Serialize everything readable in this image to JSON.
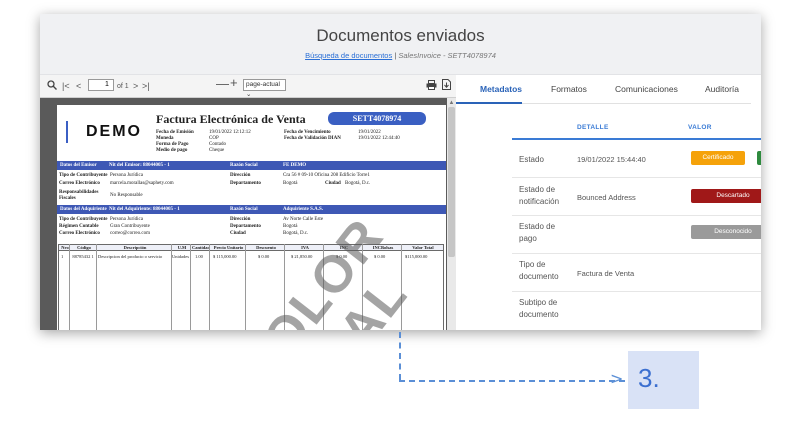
{
  "header": {
    "title": "Documentos enviados",
    "breadcrumb_link": "Búsqueda de documentos",
    "breadcrumb_sep": "|",
    "breadcrumb_current": "SalesInvoice - SETT4078974"
  },
  "viewer": {
    "page_input": "1",
    "page_of": "of 1",
    "zoom_select": "page-actual",
    "doc": {
      "logo": "DEMO",
      "title": "Factura Electrónica de Venta",
      "number": "SETT4078974",
      "meta_left_labels": [
        "Fecha de Emisión",
        "Moneda",
        "Forma de Pago",
        "Medio de pago"
      ],
      "meta_left_values": [
        "19/01/2022 12:12:12",
        "COP",
        "Contado",
        "Cheque"
      ],
      "meta_right_labels": [
        "Fecha de Vencimiento",
        "Fecha de Validación DIAN"
      ],
      "meta_right_values": [
        "19/01/2022",
        "19/01/2022 12:44:40"
      ],
      "emisor_band": [
        "Datos del Emisor",
        "Nit del Emisor: 88044005 - 1",
        "Razón Social",
        "FE DEMO"
      ],
      "emisor_rows": [
        [
          "Tipo de Contribuyente",
          "Persona Jurídica",
          "Dirección",
          "Cra 56 # 09-10 Oficina 208 Edificio Torre1"
        ],
        [
          "Correo Electrónico",
          "marcela.morallas@saphety.com",
          "Departamento",
          "Bogotá",
          "Ciudad",
          "Bogotá, D.c."
        ],
        [
          "Responsabilidades Fiscales",
          "No Responsable"
        ]
      ],
      "adquiriente_band": [
        "Datos del Adquiriente",
        "Nit del Adquiriente: 88044005 - 1",
        "Razón Social",
        "Adquiriente S.A.S."
      ],
      "adquiriente_rows": [
        [
          "Tipo de Contribuyente",
          "Persona Jurídica",
          "Dirección",
          "Av Norte Calle Este"
        ],
        [
          "Régimen Contable",
          "Gran Contribuyente",
          "Departamento",
          "Bogotá"
        ],
        [
          "Correo Electrónico",
          "correo@correo.com",
          "Ciudad",
          "Bogotá, D.c."
        ]
      ],
      "table_headers": [
        "Nro",
        "Código",
        "Descripción",
        "U.M",
        "Cantidad",
        "Precio Unitario",
        "Descuento",
        "IVA",
        "INC",
        "INCBolsas",
        "Valor Total"
      ],
      "table_row": [
        "1",
        "88785432 1",
        "Descripcion del producto o servicio",
        "Unidades",
        "1.00",
        "$ 115,000.00",
        "$ 0.00",
        "$ 21,850.00",
        "$ 0.00",
        "$ 0.00",
        "$115,000.00"
      ],
      "watermark_1": "COLOR",
      "watermark_2": "RIAL"
    }
  },
  "panel": {
    "tabs": [
      "Metadatos",
      "Formatos",
      "Comunicaciones",
      "Auditoría"
    ],
    "active_tab": "Metadatos",
    "columns": [
      "DETALLE",
      "VALOR"
    ],
    "rows": [
      {
        "label": "Estado",
        "detail": "19/01/2022 15:44:40",
        "badge": "Certificado",
        "badge_color": "#f5a20a"
      },
      {
        "label": "Estado de notificación",
        "detail": "Bounced Address",
        "badge": "Descartado",
        "badge_color": "#a01818"
      },
      {
        "label": "Estado de pago",
        "detail": "",
        "badge": "Desconocido",
        "badge_color": "#9a9a9a"
      },
      {
        "label": "Tipo de documento",
        "detail": "Factura de Venta"
      },
      {
        "label": "Subtipo de documento",
        "detail": ""
      }
    ]
  },
  "annotation": {
    "step": "3."
  }
}
